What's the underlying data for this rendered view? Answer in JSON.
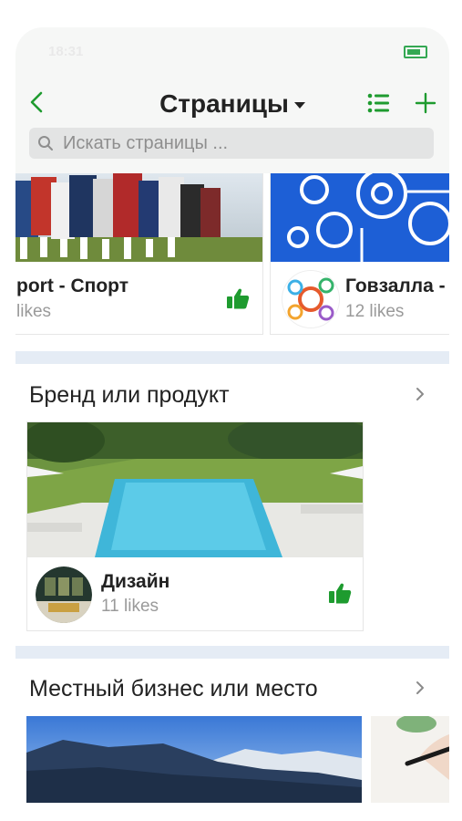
{
  "status": {
    "time": "18:31"
  },
  "header": {
    "title": "Страницы",
    "search_placeholder": "Искать страницы ..."
  },
  "top_cards": [
    {
      "name": "port - Спорт",
      "likes": "likes",
      "image": "football-players-photo"
    },
    {
      "name": "Говзалла -",
      "likes": "12 likes",
      "image": "blue-gears-illustration"
    }
  ],
  "sections": [
    {
      "title": "Бренд или продукт",
      "card": {
        "name": "Дизайн",
        "likes": "11 likes",
        "image": "pool-villa-photo"
      }
    },
    {
      "title": "Местный бизнес или место",
      "images": [
        "mountain-lake-photo",
        "hand-writing-photo"
      ]
    }
  ],
  "colors": {
    "accent": "#1e9b2f",
    "divider": "#e5ecf5",
    "topbar_bg": "#f6f7f6"
  }
}
